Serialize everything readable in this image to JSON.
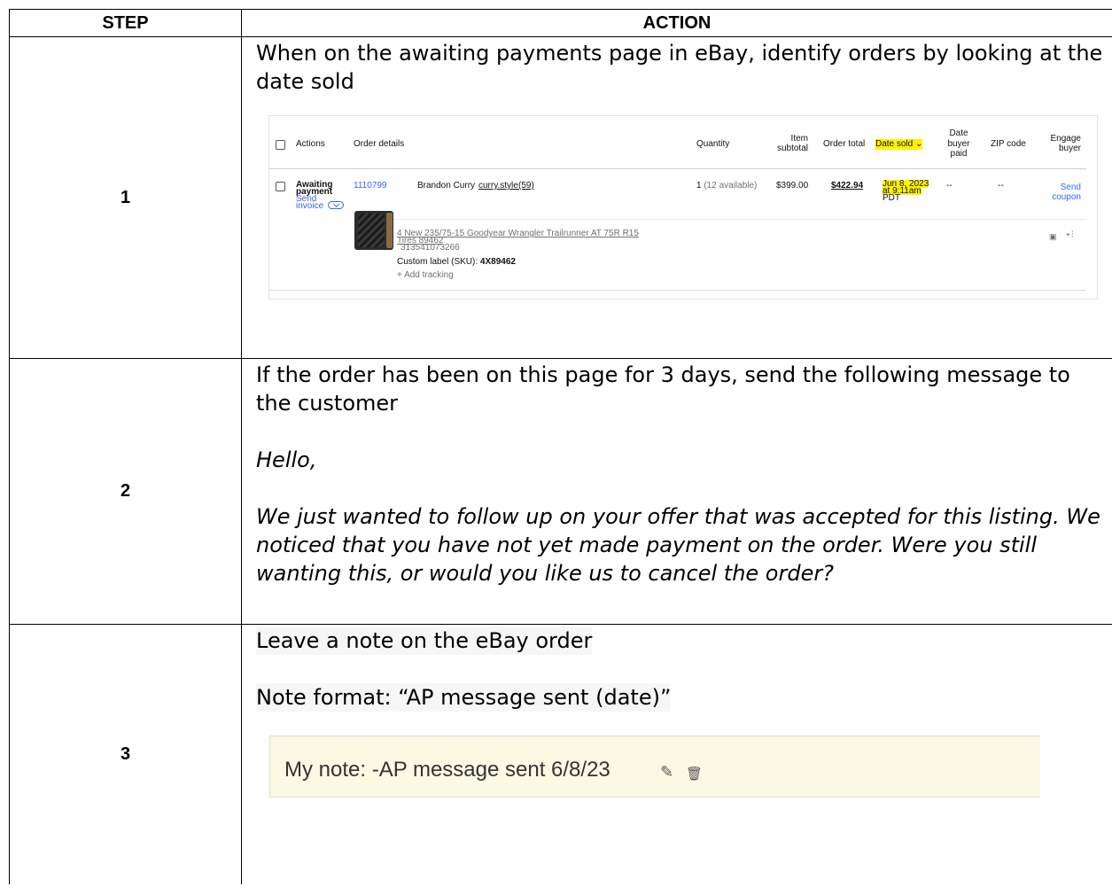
{
  "table": {
    "header_step": "STEP",
    "header_action": "ACTION"
  },
  "steps": [
    {
      "number": "1",
      "text": "When on the awaiting payments page in eBay, identify orders by looking at the date sold"
    },
    {
      "number": "2",
      "text": "If the order has been on this page for 3 days, send the following message to the customer",
      "greeting": "Hello,",
      "message": "We just wanted to follow up on your offer that was accepted for this listing. We noticed that you have not yet made payment on the order. Were you still wanting this, or would you like us to cancel the order?"
    },
    {
      "number": "3",
      "text": "Leave a note on the eBay order",
      "format": "Note format: “AP message sent (date)”"
    }
  ],
  "ebay": {
    "columns": {
      "actions": "Actions",
      "order_details": "Order details",
      "quantity": "Quantity",
      "item": "Item",
      "subtotal": "subtotal",
      "order_total": "Order total",
      "date_sold": "Date sold",
      "date": "Date",
      "buyer": "buyer",
      "paid": "paid",
      "zip": "ZIP code",
      "engage": "Engage",
      "engage_buyer": "buyer"
    },
    "order": {
      "status_1": "Awaiting",
      "status_2": "payment",
      "send_1": "Send",
      "send_2": "invoice",
      "order_number": "1110799",
      "buyer_name": "Brandon Curry",
      "buyer_user": "curry.style",
      "feedback": "(59)",
      "quantity": "1",
      "available": "(12 available)",
      "item_subtotal": "$399.00",
      "order_total": "$422.94",
      "date_sold_1": "Jun 8, 2023",
      "date_sold_2": "at 9:11am",
      "date_sold_3": "PDT",
      "date_paid": "--",
      "zip": "--",
      "coupon_1": "Send",
      "coupon_2": "coupon"
    },
    "item": {
      "title_1": "4 New 235/75-15 Goodyear Wrangler Trailrunner AT 75R R15",
      "title_2": "Tires 89462",
      "item_id": "313541073266",
      "sku_label": "Custom label (SKU):",
      "sku": "4X89462",
      "add_tracking": "+ Add tracking"
    }
  },
  "note": {
    "text": "My note:  -AP message sent 6/8/23"
  },
  "icons": {
    "chevron": "chevron-down-icon",
    "camera": "camera-icon",
    "pin": "pin-icon",
    "edit": "pencil-icon",
    "delete": "trash-icon"
  },
  "colors": {
    "link": "#3665f3",
    "highlight": "#fff200",
    "note_bg": "#fbf8e3"
  }
}
